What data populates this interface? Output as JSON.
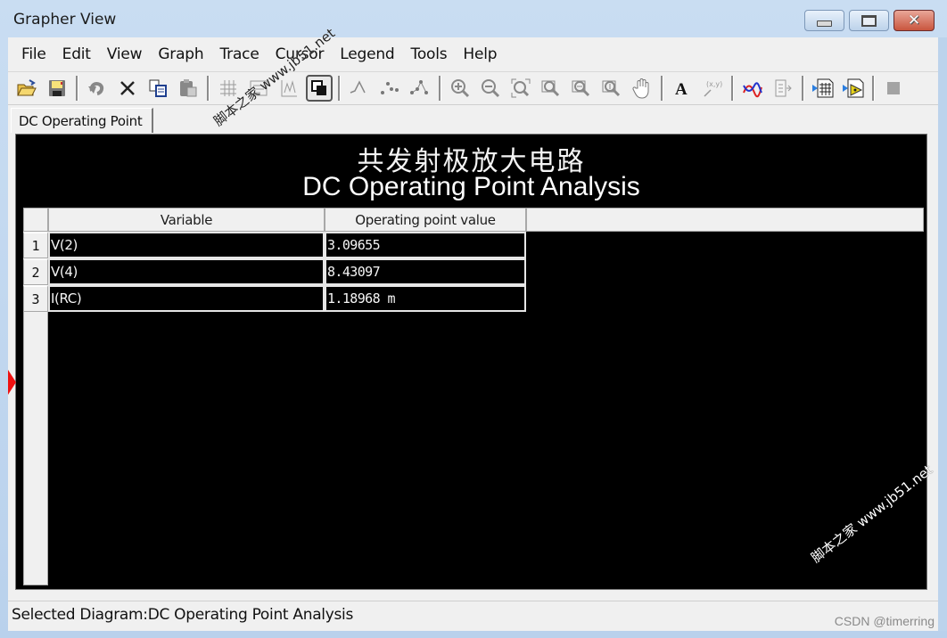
{
  "window": {
    "title": "Grapher View",
    "controls": {
      "minimize": "minimize",
      "maximize": "maximize",
      "close": "✕"
    }
  },
  "menu": [
    "File",
    "Edit",
    "View",
    "Graph",
    "Trace",
    "Cursor",
    "Legend",
    "Tools",
    "Help"
  ],
  "toolbar": {
    "groups": [
      [
        "open-icon",
        "save-icon"
      ],
      [
        "undo-icon",
        "delete-icon",
        "copy-icon",
        "paste-icon"
      ],
      [
        "grid-icon",
        "legend-icon",
        "chart-icon",
        "overlay-icon"
      ],
      [
        "line-icon",
        "points-icon",
        "line-points-icon"
      ],
      [
        "zoom-in-icon",
        "zoom-out-icon",
        "zoom-fit-icon",
        "zoom-x-icon",
        "zoom-y-icon",
        "zoom-xy-icon",
        "pan-hand-icon"
      ],
      [
        "text-icon",
        "label-xy-icon"
      ],
      [
        "trace-icon",
        "export-icon"
      ],
      [
        "export-table-icon",
        "export-diagram-icon"
      ],
      [
        "stop-icon"
      ]
    ]
  },
  "tabs": [
    {
      "label": "DC Operating Point",
      "active": true
    }
  ],
  "diagram": {
    "title_cn": "共发射极放大电路",
    "title_en": "DC Operating Point Analysis",
    "columns": [
      "Variable",
      "Operating point value"
    ],
    "rows": [
      {
        "index": "1",
        "variable": "V(2)",
        "value": "3.09655"
      },
      {
        "index": "2",
        "variable": "V(4)",
        "value": "8.43097"
      },
      {
        "index": "3",
        "variable": "I(RC)",
        "value": "1.18968 m"
      }
    ],
    "background_color": "#000000",
    "text_color": "#ffffff"
  },
  "status": {
    "text": "Selected Diagram:DC Operating Point Analysis"
  },
  "overlays": {
    "watermark1": "脚本之家 www.jb51.net",
    "watermark2": "脚本之家 www.jb51.net",
    "credit": "CSDN @timerring"
  }
}
